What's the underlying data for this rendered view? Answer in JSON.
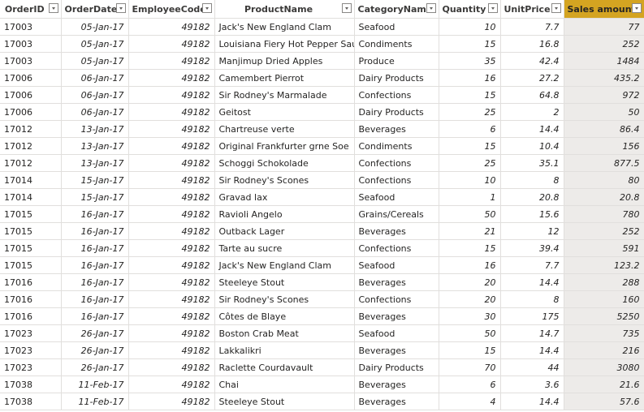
{
  "columns": [
    {
      "label": "OrderID",
      "key": "id"
    },
    {
      "label": "OrderDate",
      "key": "date"
    },
    {
      "label": "EmployeeCode",
      "key": "emp"
    },
    {
      "label": "ProductName",
      "key": "product"
    },
    {
      "label": "CategoryName",
      "key": "category"
    },
    {
      "label": "Quantity",
      "key": "qty"
    },
    {
      "label": "UnitPrice",
      "key": "price"
    },
    {
      "label": "Sales amount",
      "key": "sales",
      "selected": true
    }
  ],
  "accent_color": "#d4a421",
  "rows": [
    [
      "17003",
      "05-Jan-17",
      "49182",
      "Jack's New England Clam",
      "Seafood",
      "10",
      "7.7",
      "77"
    ],
    [
      "17003",
      "05-Jan-17",
      "49182",
      "Louisiana Fiery Hot Pepper Sauce",
      "Condiments",
      "15",
      "16.8",
      "252"
    ],
    [
      "17003",
      "05-Jan-17",
      "49182",
      "Manjimup Dried Apples",
      "Produce",
      "35",
      "42.4",
      "1484"
    ],
    [
      "17006",
      "06-Jan-17",
      "49182",
      "Camembert Pierrot",
      "Dairy Products",
      "16",
      "27.2",
      "435.2"
    ],
    [
      "17006",
      "06-Jan-17",
      "49182",
      "Sir Rodney's Marmalade",
      "Confections",
      "15",
      "64.8",
      "972"
    ],
    [
      "17006",
      "06-Jan-17",
      "49182",
      "Geitost",
      "Dairy Products",
      "25",
      "2",
      "50"
    ],
    [
      "17012",
      "13-Jan-17",
      "49182",
      "Chartreuse verte",
      "Beverages",
      "6",
      "14.4",
      "86.4"
    ],
    [
      "17012",
      "13-Jan-17",
      "49182",
      "Original Frankfurter grne Soe",
      "Condiments",
      "15",
      "10.4",
      "156"
    ],
    [
      "17012",
      "13-Jan-17",
      "49182",
      "Schoggi Schokolade",
      "Confections",
      "25",
      "35.1",
      "877.5"
    ],
    [
      "17014",
      "15-Jan-17",
      "49182",
      "Sir Rodney's Scones",
      "Confections",
      "10",
      "8",
      "80"
    ],
    [
      "17014",
      "15-Jan-17",
      "49182",
      "Gravad lax",
      "Seafood",
      "1",
      "20.8",
      "20.8"
    ],
    [
      "17015",
      "16-Jan-17",
      "49182",
      "Ravioli Angelo",
      "Grains/Cereals",
      "50",
      "15.6",
      "780"
    ],
    [
      "17015",
      "16-Jan-17",
      "49182",
      "Outback Lager",
      "Beverages",
      "21",
      "12",
      "252"
    ],
    [
      "17015",
      "16-Jan-17",
      "49182",
      "Tarte au sucre",
      "Confections",
      "15",
      "39.4",
      "591"
    ],
    [
      "17015",
      "16-Jan-17",
      "49182",
      "Jack's New England Clam",
      "Seafood",
      "16",
      "7.7",
      "123.2"
    ],
    [
      "17016",
      "16-Jan-17",
      "49182",
      "Steeleye Stout",
      "Beverages",
      "20",
      "14.4",
      "288"
    ],
    [
      "17016",
      "16-Jan-17",
      "49182",
      "Sir Rodney's Scones",
      "Confections",
      "20",
      "8",
      "160"
    ],
    [
      "17016",
      "16-Jan-17",
      "49182",
      "Côtes de Blaye",
      "Beverages",
      "30",
      "175",
      "5250"
    ],
    [
      "17023",
      "26-Jan-17",
      "49182",
      "Boston Crab Meat",
      "Seafood",
      "50",
      "14.7",
      "735"
    ],
    [
      "17023",
      "26-Jan-17",
      "49182",
      "Lakkalikri",
      "Beverages",
      "15",
      "14.4",
      "216"
    ],
    [
      "17023",
      "26-Jan-17",
      "49182",
      "Raclette Courdavault",
      "Dairy Products",
      "70",
      "44",
      "3080"
    ],
    [
      "17038",
      "11-Feb-17",
      "49182",
      "Chai",
      "Beverages",
      "6",
      "3.6",
      "21.6"
    ],
    [
      "17038",
      "11-Feb-17",
      "49182",
      "Steeleye Stout",
      "Beverages",
      "4",
      "14.4",
      "57.6"
    ]
  ]
}
